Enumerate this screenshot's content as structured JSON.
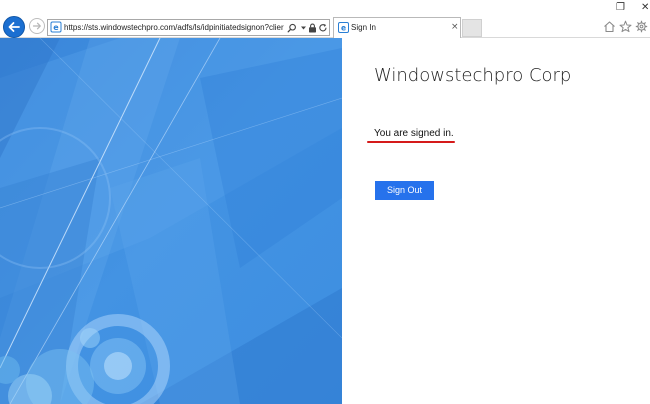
{
  "browser": {
    "address_url": "https://sts.windowstechpro.com/adfs/ls/idpinitiatedsignon?clier",
    "tab_title": "Sign In",
    "tab_close": "×",
    "window_controls": {
      "restore": "❐",
      "close": "✕"
    }
  },
  "page": {
    "company_name": "Windowstechpro Corp",
    "status_message": "You are signed in.",
    "sign_out_label": "Sign Out"
  },
  "colors": {
    "accent_blue": "#2672ec",
    "hero_blue": "#3f8fe0",
    "annotation_red": "#d51a1a"
  },
  "icons": [
    "back-arrow-icon",
    "forward-arrow-icon",
    "ie-page-icon",
    "search-icon",
    "dropdown-icon",
    "lock-icon",
    "refresh-icon",
    "tab-page-icon",
    "home-icon",
    "favorites-star-icon",
    "settings-gear-icon"
  ]
}
